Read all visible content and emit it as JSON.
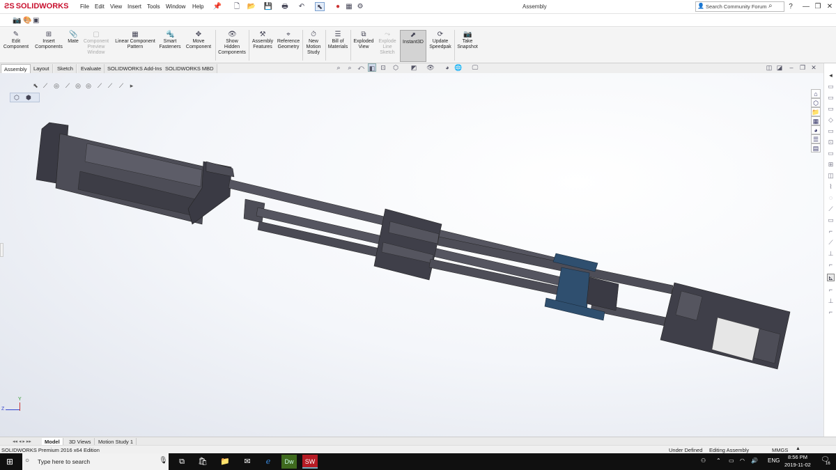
{
  "titlebar": {
    "app_name": "SOLIDWORKS",
    "menus": [
      "File",
      "Edit",
      "View",
      "Insert",
      "Tools",
      "Window",
      "Help"
    ],
    "document_title": "Assembly",
    "search_placeholder": "Search Community Forum",
    "help_label": "?"
  },
  "command_manager": {
    "buttons": [
      {
        "label": "Edit\nComponent",
        "icon": "edit-component-icon"
      },
      {
        "label": "Insert\nComponents",
        "icon": "insert-components-icon"
      },
      {
        "label": "Mate",
        "icon": "mate-icon"
      },
      {
        "label": "Component\nPreview\nWindow",
        "icon": "preview-window-icon"
      },
      {
        "label": "Linear Component\nPattern",
        "icon": "linear-pattern-icon"
      },
      {
        "label": "Smart\nFasteners",
        "icon": "smart-fasteners-icon"
      },
      {
        "label": "Move\nComponent",
        "icon": "move-component-icon"
      },
      {
        "label": "Show\nHidden\nComponents",
        "icon": "show-hidden-icon"
      },
      {
        "label": "Assembly\nFeatures",
        "icon": "assembly-features-icon"
      },
      {
        "label": "Reference\nGeometry",
        "icon": "reference-geometry-icon"
      },
      {
        "label": "New\nMotion\nStudy",
        "icon": "motion-study-icon"
      },
      {
        "label": "Bill of\nMaterials",
        "icon": "bom-icon"
      },
      {
        "label": "Exploded\nView",
        "icon": "exploded-view-icon"
      },
      {
        "label": "Explode\nLine\nSketch",
        "icon": "explode-line-icon"
      },
      {
        "label": "Instant3D",
        "icon": "instant3d-icon"
      },
      {
        "label": "Update\nSpeedpak",
        "icon": "speedpak-icon"
      },
      {
        "label": "Take\nSnapshot",
        "icon": "snapshot-icon"
      }
    ]
  },
  "tabs": [
    "Assembly",
    "Layout",
    "Sketch",
    "Evaluate",
    "SOLIDWORKS Add-Ins",
    "SOLIDWORKS MBD"
  ],
  "bottom_tabs": [
    "Model",
    "3D Views",
    "Motion Study 1"
  ],
  "status": {
    "edition": "SOLIDWORKS Premium 2016 x64 Edition",
    "definition": "Under Defined",
    "mode": "Editing Assembly",
    "units": "MMGS"
  },
  "triad": {
    "x_label": "X",
    "y_label": "Y",
    "z_label": "Z"
  },
  "taskbar": {
    "search_placeholder": "Type here to search",
    "language": "ENG",
    "time": "8:56 PM",
    "date": "2019-11-02",
    "notifications": "16"
  },
  "colors": {
    "brand_red": "#c8102e",
    "part_gray": "#4d4d57",
    "part_dark": "#3a3a44",
    "part_blue": "#2f4f6f",
    "active_tab": "#ffffff"
  }
}
